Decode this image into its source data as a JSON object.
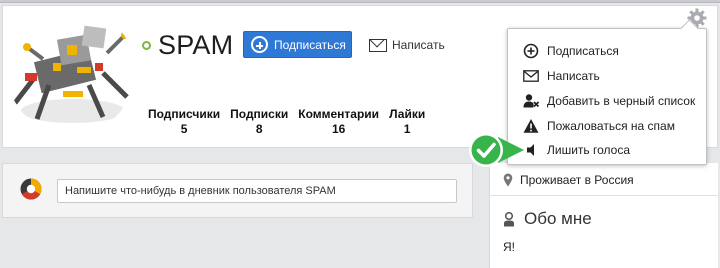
{
  "profile": {
    "username": "SPAM",
    "subscribe_label": "Подписаться",
    "write_label": "Написать",
    "stats": [
      {
        "label": "Подписчики",
        "value": "5"
      },
      {
        "label": "Подписки",
        "value": "8"
      },
      {
        "label": "Комментарии",
        "value": "16"
      },
      {
        "label": "Лайки",
        "value": "1"
      }
    ]
  },
  "menu": {
    "items": [
      {
        "label": "Подписаться",
        "icon": "plus-circle-icon"
      },
      {
        "label": "Написать",
        "icon": "envelope-icon"
      },
      {
        "label": "Добавить в черный список",
        "icon": "user-block-icon"
      },
      {
        "label": "Пожаловаться на спам",
        "icon": "warning-icon"
      },
      {
        "label": "Лишить голоса",
        "icon": "mute-speaker-icon"
      }
    ]
  },
  "post": {
    "placeholder": "Напишите что-нибудь в дневник пользователя SPAM"
  },
  "sidebar": {
    "location": "Проживает в Россия",
    "about_title": "Обо мне",
    "about_text": "Я!"
  },
  "colors": {
    "accent": "#2e79d6",
    "online": "#7ab83f",
    "callout": "#37b54a"
  }
}
